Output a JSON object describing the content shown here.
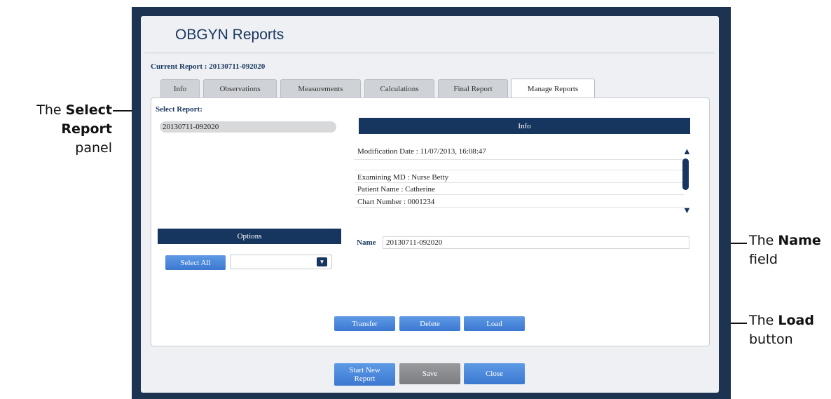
{
  "app": {
    "title": "OBGYN Reports",
    "current_report_label": "Current Report : 20130711-092020"
  },
  "tabs": [
    {
      "label": "Info",
      "active": false
    },
    {
      "label": "Observations",
      "active": false
    },
    {
      "label": "Measurements",
      "active": false
    },
    {
      "label": "Calculations",
      "active": false
    },
    {
      "label": "Final Report",
      "active": false
    },
    {
      "label": "Manage Reports",
      "active": true
    }
  ],
  "select_report": {
    "label": "Select Report:",
    "items": [
      "20130711-092020"
    ]
  },
  "info": {
    "header": "Info",
    "modification_date": "Modification Date : 11/07/2013, 16:08:47",
    "examining_md": "Examining MD : Nurse Betty",
    "patient_name": "Patient Name : Catherine",
    "chart_number": "Chart Number : 0001234",
    "scroll_up_icon": "triangle-up",
    "scroll_down_icon": "triangle-down"
  },
  "options": {
    "header": "Options",
    "select_all_label": "Select All",
    "dropdown_value": ""
  },
  "name_field": {
    "label": "Name",
    "value": "20130711-092020"
  },
  "actions": {
    "transfer_label": "Transfer",
    "delete_label": "Delete",
    "load_label": "Load"
  },
  "footer": {
    "start_new_line1": "Start New",
    "start_new_line2": "Report",
    "save_label": "Save",
    "close_label": "Close"
  },
  "callouts": {
    "select_report_bold1": "Select",
    "select_report_pre": "The ",
    "select_report_bold2": "Report",
    "select_report_post": " panel",
    "name_pre": "The ",
    "name_bold": "Name",
    "name_post": "field",
    "load_pre": "The ",
    "load_bold": "Load",
    "load_post": "button"
  },
  "colors": {
    "navy": "#17365f",
    "button_blue": "#3b78d0",
    "button_gray": "#7c7d80"
  }
}
